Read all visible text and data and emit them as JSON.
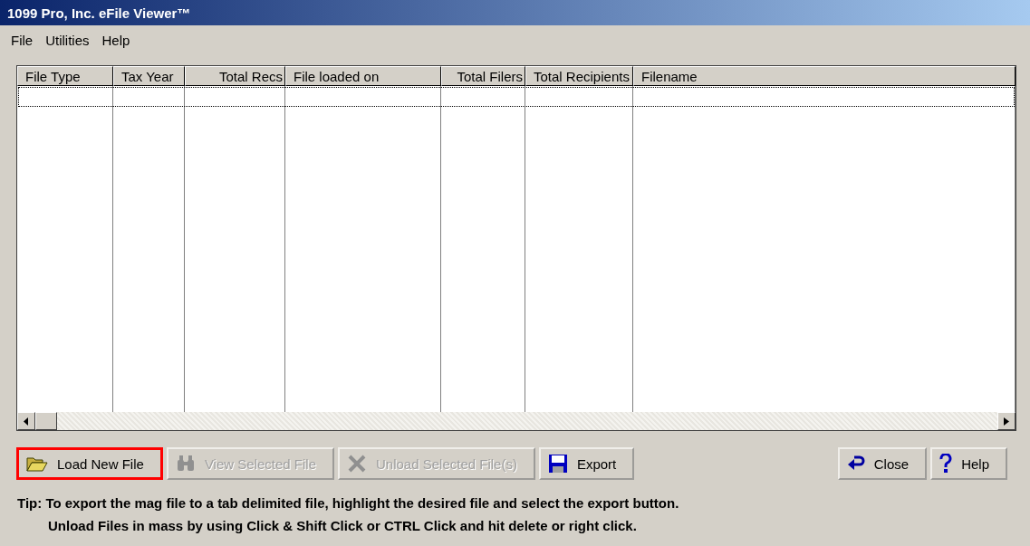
{
  "window": {
    "title": "1099 Pro, Inc. eFile Viewer™"
  },
  "menu": [
    "File",
    "Utilities",
    "Help"
  ],
  "table": {
    "focus_row": true,
    "columns": [
      "File Type",
      "Tax Year",
      "Total Recs",
      "File loaded on",
      "Total Filers",
      "Total Recipients",
      "Filename"
    ]
  },
  "buttons": [
    {
      "label": "Load New File",
      "kind": "load",
      "disabled": false,
      "highlighted": true
    },
    {
      "label": "View Selected File",
      "kind": "view",
      "disabled": true,
      "highlighted": false
    },
    {
      "label": "Unload Selected File(s)",
      "kind": "unload",
      "disabled": true,
      "highlighted": false
    },
    {
      "label": "Export",
      "kind": "export",
      "disabled": false,
      "highlighted": false
    }
  ],
  "right_buttons": [
    {
      "label": "Close",
      "kind": "close",
      "disabled": false,
      "highlighted": false
    },
    {
      "label": "Help",
      "kind": "help",
      "disabled": false,
      "highlighted": false
    }
  ],
  "tips": [
    "Tip: To export the mag file to a tab delimited file, highlight the desired file and select the export button.",
    "Unload Files in mass by using Click & Shift Click or CTRL Click and hit delete or right click."
  ]
}
